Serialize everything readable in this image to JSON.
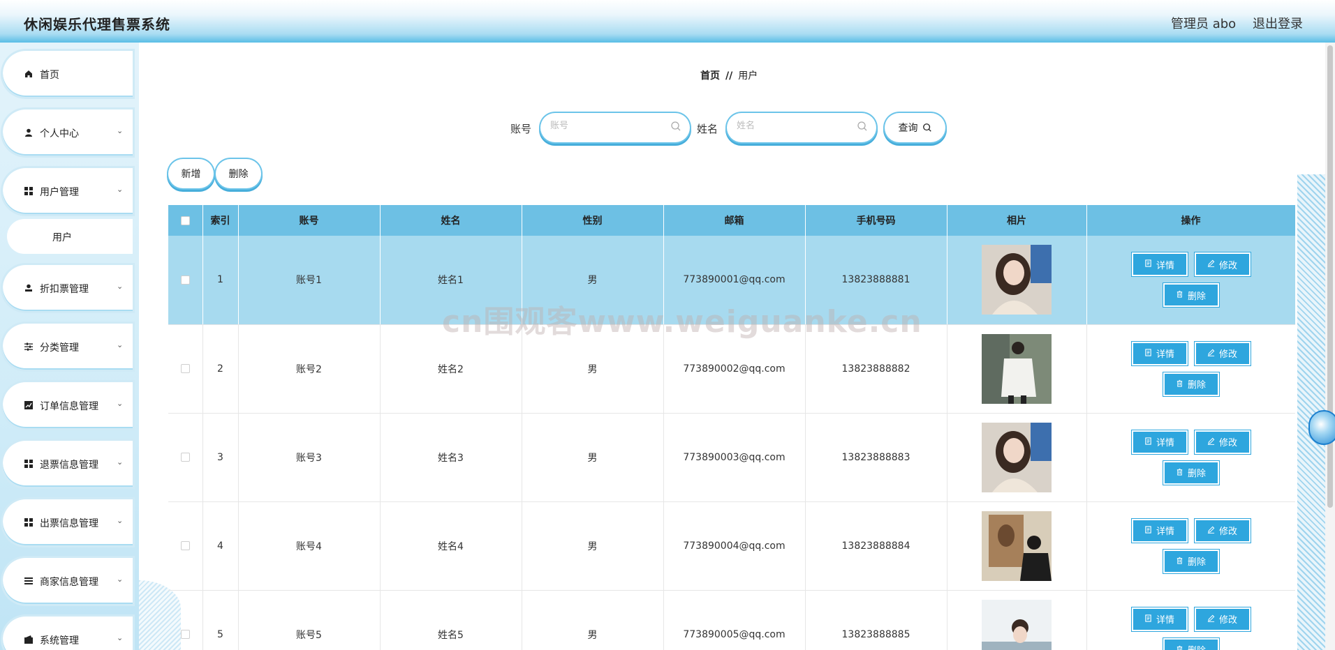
{
  "header": {
    "title": "休闲娱乐代理售票系统",
    "admin": "管理员 abo",
    "logout": "退出登录"
  },
  "sidebar": {
    "items": [
      {
        "label": "首页",
        "icon": "home-icon"
      },
      {
        "label": "个人中心",
        "icon": "user-icon"
      },
      {
        "label": "用户管理",
        "icon": "grid-icon"
      },
      {
        "label": "用户",
        "sub": true
      },
      {
        "label": "折扣票管理",
        "icon": "user-upload-icon"
      },
      {
        "label": "分类管理",
        "icon": "sliders-icon"
      },
      {
        "label": "订单信息管理",
        "icon": "chart-icon"
      },
      {
        "label": "退票信息管理",
        "icon": "grid-icon"
      },
      {
        "label": "出票信息管理",
        "icon": "grid-icon"
      },
      {
        "label": "商家信息管理",
        "icon": "list-icon"
      },
      {
        "label": "系统管理",
        "icon": "wallet-icon"
      }
    ]
  },
  "breadcrumb": {
    "home": "首页",
    "sep": "//",
    "current": "用户"
  },
  "search": {
    "account_label": "账号",
    "account_placeholder": "账号",
    "name_label": "姓名",
    "name_placeholder": "姓名",
    "query_label": "查询"
  },
  "toolbar": {
    "add_label": "新增",
    "delete_label": "删除"
  },
  "table": {
    "columns": [
      "索引",
      "账号",
      "姓名",
      "性别",
      "邮箱",
      "手机号码",
      "相片",
      "操作"
    ],
    "rows": [
      {
        "index": "1",
        "account": "账号1",
        "name": "姓名1",
        "gender": "男",
        "email": "773890001@qq.com",
        "phone": "13823888881"
      },
      {
        "index": "2",
        "account": "账号2",
        "name": "姓名2",
        "gender": "男",
        "email": "773890002@qq.com",
        "phone": "13823888882"
      },
      {
        "index": "3",
        "account": "账号3",
        "name": "姓名3",
        "gender": "男",
        "email": "773890003@qq.com",
        "phone": "13823888883"
      },
      {
        "index": "4",
        "account": "账号4",
        "name": "姓名4",
        "gender": "男",
        "email": "773890004@qq.com",
        "phone": "13823888884"
      },
      {
        "index": "5",
        "account": "账号5",
        "name": "姓名5",
        "gender": "男",
        "email": "773890005@qq.com",
        "phone": "13823888885"
      }
    ],
    "actions": {
      "detail": "详情",
      "edit": "修改",
      "delete": "删除"
    }
  },
  "watermark": "cn围观客www.weiguanke.cn",
  "colors": {
    "accent": "#2ea6de",
    "header_row": "#6dc0e4",
    "highlight_row": "#a7daef"
  }
}
